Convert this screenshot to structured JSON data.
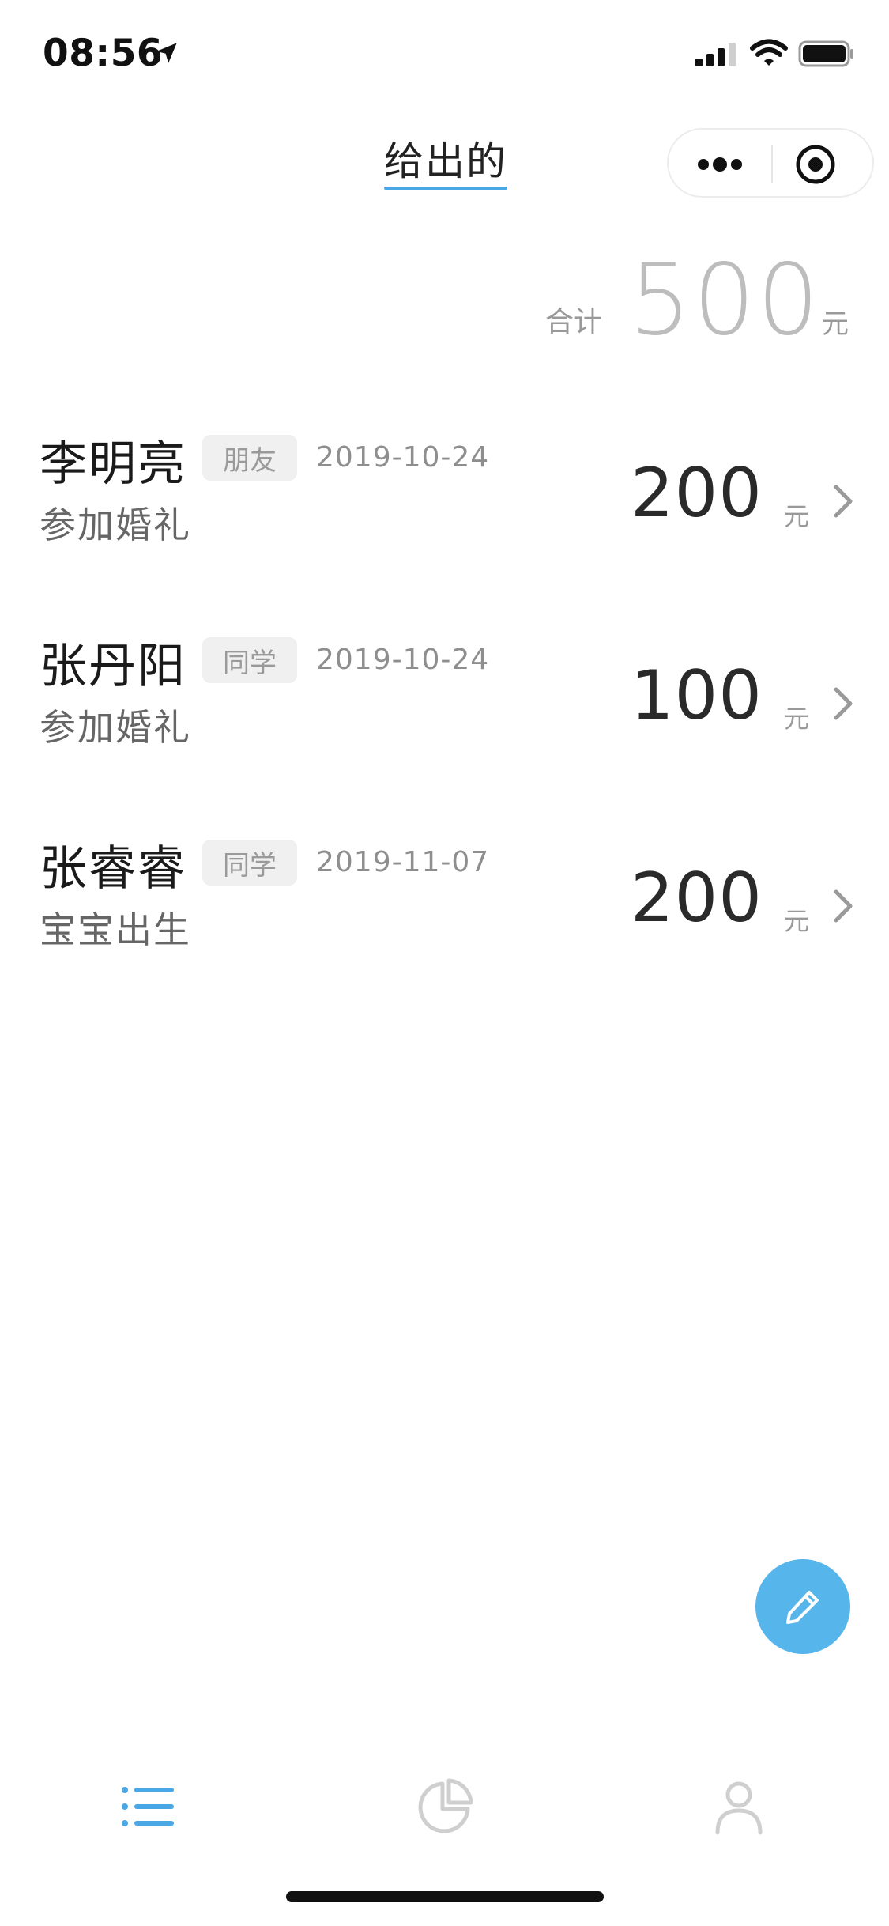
{
  "status_bar": {
    "time": "08:56"
  },
  "nav": {
    "title": "给出的"
  },
  "summary": {
    "label": "合计",
    "value": "500",
    "unit": "元"
  },
  "records": [
    {
      "name": "李明亮",
      "tag": "朋友",
      "date": "2019-10-24",
      "note": "参加婚礼",
      "amount": "200",
      "unit": "元"
    },
    {
      "name": "张丹阳",
      "tag": "同学",
      "date": "2019-10-24",
      "note": "参加婚礼",
      "amount": "100",
      "unit": "元"
    },
    {
      "name": "张睿睿",
      "tag": "同学",
      "date": "2019-11-07",
      "note": "宝宝出生",
      "amount": "200",
      "unit": "元"
    }
  ],
  "icons": {
    "fab": "pencil-icon",
    "tabs": [
      "list-icon",
      "pie-chart-icon",
      "person-icon"
    ]
  },
  "colors": {
    "accent": "#4aa7e6",
    "fab": "#56b5ea",
    "tab_inactive": "#cfcfcf"
  }
}
